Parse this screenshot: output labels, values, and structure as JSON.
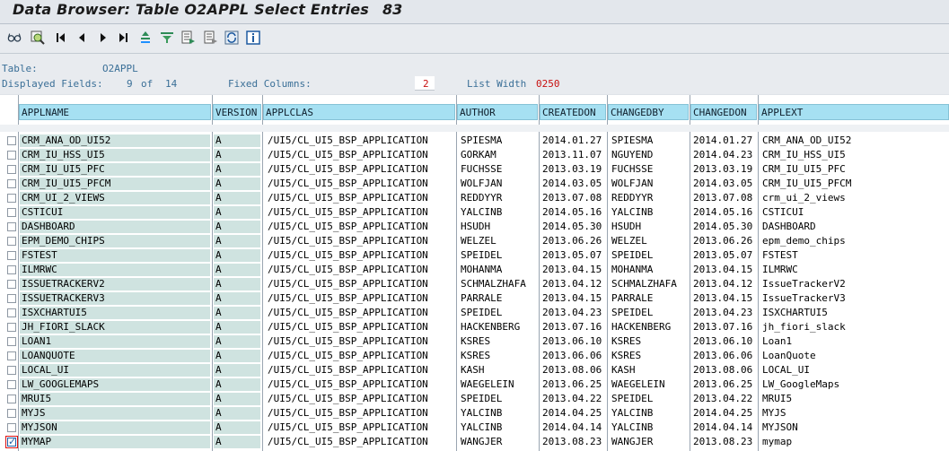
{
  "title": "Data Browser: Table O2APPL Select Entries",
  "entry_count": "83",
  "toolbar": {
    "icons": [
      "glasses-icon",
      "detail-icon",
      "first-page-icon",
      "prev-page-icon",
      "next-page-icon",
      "last-page-icon",
      "sort-icon",
      "filter-icon",
      "check-table-icon",
      "export-icon",
      "refresh-icon",
      "info-icon"
    ]
  },
  "info": {
    "table_label": "Table:",
    "table_value": "O2APPL",
    "displayed_label": "Displayed Fields:",
    "displayed_value": "9",
    "of_label": "of",
    "total_fields": "14",
    "fixed_label": "Fixed Columns:",
    "fixed_value": "2",
    "listwidth_label": "List Width",
    "listwidth_value": "0250"
  },
  "columns": [
    "APPLNAME",
    "VERSION",
    "APPLCLAS",
    "AUTHOR",
    "CREATEDON",
    "CHANGEDBY",
    "CHANGEDON",
    "APPLEXT"
  ],
  "rows": [
    {
      "applname": "CRM_ANA_OD_UI52",
      "version": "A",
      "applclas": "/UI5/CL_UI5_BSP_APPLICATION",
      "author": "SPIESMA",
      "createdon": "2014.01.27",
      "changedby": "SPIESMA",
      "changedon": "2014.01.27",
      "applext": "CRM_ANA_OD_UI52",
      "checked": false
    },
    {
      "applname": "CRM_IU_HSS_UI5",
      "version": "A",
      "applclas": "/UI5/CL_UI5_BSP_APPLICATION",
      "author": "GORKAM",
      "createdon": "2013.11.07",
      "changedby": "NGUYEND",
      "changedon": "2014.04.23",
      "applext": "CRM_IU_HSS_UI5",
      "checked": false
    },
    {
      "applname": "CRM_IU_UI5_PFC",
      "version": "A",
      "applclas": "/UI5/CL_UI5_BSP_APPLICATION",
      "author": "FUCHSSE",
      "createdon": "2013.03.19",
      "changedby": "FUCHSSE",
      "changedon": "2013.03.19",
      "applext": "CRM_IU_UI5_PFC",
      "checked": false
    },
    {
      "applname": "CRM_IU_UI5_PFCM",
      "version": "A",
      "applclas": "/UI5/CL_UI5_BSP_APPLICATION",
      "author": "WOLFJAN",
      "createdon": "2014.03.05",
      "changedby": "WOLFJAN",
      "changedon": "2014.03.05",
      "applext": "CRM_IU_UI5_PFCM",
      "checked": false
    },
    {
      "applname": "CRM_UI_2_VIEWS",
      "version": "A",
      "applclas": "/UI5/CL_UI5_BSP_APPLICATION",
      "author": "REDDYYR",
      "createdon": "2013.07.08",
      "changedby": "REDDYYR",
      "changedon": "2013.07.08",
      "applext": "crm_ui_2_views",
      "checked": false
    },
    {
      "applname": "CSTICUI",
      "version": "A",
      "applclas": "/UI5/CL_UI5_BSP_APPLICATION",
      "author": "YALCINB",
      "createdon": "2014.05.16",
      "changedby": "YALCINB",
      "changedon": "2014.05.16",
      "applext": "CSTICUI",
      "checked": false
    },
    {
      "applname": "DASHBOARD",
      "version": "A",
      "applclas": "/UI5/CL_UI5_BSP_APPLICATION",
      "author": "HSUDH",
      "createdon": "2014.05.30",
      "changedby": "HSUDH",
      "changedon": "2014.05.30",
      "applext": "DASHBOARD",
      "checked": false
    },
    {
      "applname": "EPM_DEMO_CHIPS",
      "version": "A",
      "applclas": "/UI5/CL_UI5_BSP_APPLICATION",
      "author": "WELZEL",
      "createdon": "2013.06.26",
      "changedby": "WELZEL",
      "changedon": "2013.06.26",
      "applext": "epm_demo_chips",
      "checked": false
    },
    {
      "applname": "FSTEST",
      "version": "A",
      "applclas": "/UI5/CL_UI5_BSP_APPLICATION",
      "author": "SPEIDEL",
      "createdon": "2013.05.07",
      "changedby": "SPEIDEL",
      "changedon": "2013.05.07",
      "applext": "FSTEST",
      "checked": false
    },
    {
      "applname": "ILMRWC",
      "version": "A",
      "applclas": "/UI5/CL_UI5_BSP_APPLICATION",
      "author": "MOHANMA",
      "createdon": "2013.04.15",
      "changedby": "MOHANMA",
      "changedon": "2013.04.15",
      "applext": "ILMRWC",
      "checked": false
    },
    {
      "applname": "ISSUETRACKERV2",
      "version": "A",
      "applclas": "/UI5/CL_UI5_BSP_APPLICATION",
      "author": "SCHMALZHAFA",
      "createdon": "2013.04.12",
      "changedby": "SCHMALZHAFA",
      "changedon": "2013.04.12",
      "applext": "IssueTrackerV2",
      "checked": false
    },
    {
      "applname": "ISSUETRACKERV3",
      "version": "A",
      "applclas": "/UI5/CL_UI5_BSP_APPLICATION",
      "author": "PARRALE",
      "createdon": "2013.04.15",
      "changedby": "PARRALE",
      "changedon": "2013.04.15",
      "applext": "IssueTrackerV3",
      "checked": false
    },
    {
      "applname": "ISXCHARTUI5",
      "version": "A",
      "applclas": "/UI5/CL_UI5_BSP_APPLICATION",
      "author": "SPEIDEL",
      "createdon": "2013.04.23",
      "changedby": "SPEIDEL",
      "changedon": "2013.04.23",
      "applext": "ISXCHARTUI5",
      "checked": false
    },
    {
      "applname": "JH_FIORI_SLACK",
      "version": "A",
      "applclas": "/UI5/CL_UI5_BSP_APPLICATION",
      "author": "HACKENBERG",
      "createdon": "2013.07.16",
      "changedby": "HACKENBERG",
      "changedon": "2013.07.16",
      "applext": "jh_fiori_slack",
      "checked": false
    },
    {
      "applname": "LOAN1",
      "version": "A",
      "applclas": "/UI5/CL_UI5_BSP_APPLICATION",
      "author": "KSRES",
      "createdon": "2013.06.10",
      "changedby": "KSRES",
      "changedon": "2013.06.10",
      "applext": "Loan1",
      "checked": false
    },
    {
      "applname": "LOANQUOTE",
      "version": "A",
      "applclas": "/UI5/CL_UI5_BSP_APPLICATION",
      "author": "KSRES",
      "createdon": "2013.06.06",
      "changedby": "KSRES",
      "changedon": "2013.06.06",
      "applext": "LoanQuote",
      "checked": false
    },
    {
      "applname": "LOCAL_UI",
      "version": "A",
      "applclas": "/UI5/CL_UI5_BSP_APPLICATION",
      "author": "KASH",
      "createdon": "2013.08.06",
      "changedby": "KASH",
      "changedon": "2013.08.06",
      "applext": "LOCAL_UI",
      "checked": false
    },
    {
      "applname": "LW_GOOGLEMAPS",
      "version": "A",
      "applclas": "/UI5/CL_UI5_BSP_APPLICATION",
      "author": "WAEGELEIN",
      "createdon": "2013.06.25",
      "changedby": "WAEGELEIN",
      "changedon": "2013.06.25",
      "applext": "LW_GoogleMaps",
      "checked": false
    },
    {
      "applname": "MRUI5",
      "version": "A",
      "applclas": "/UI5/CL_UI5_BSP_APPLICATION",
      "author": "SPEIDEL",
      "createdon": "2013.04.22",
      "changedby": "SPEIDEL",
      "changedon": "2013.04.22",
      "applext": "MRUI5",
      "checked": false
    },
    {
      "applname": "MYJS",
      "version": "A",
      "applclas": "/UI5/CL_UI5_BSP_APPLICATION",
      "author": "YALCINB",
      "createdon": "2014.04.25",
      "changedby": "YALCINB",
      "changedon": "2014.04.25",
      "applext": "MYJS",
      "checked": false
    },
    {
      "applname": "MYJSON",
      "version": "A",
      "applclas": "/UI5/CL_UI5_BSP_APPLICATION",
      "author": "YALCINB",
      "createdon": "2014.04.14",
      "changedby": "YALCINB",
      "changedon": "2014.04.14",
      "applext": "MYJSON",
      "checked": false
    },
    {
      "applname": "MYMAP",
      "version": "A",
      "applclas": "/UI5/CL_UI5_BSP_APPLICATION",
      "author": "WANGJER",
      "createdon": "2013.08.23",
      "changedby": "WANGJER",
      "changedon": "2013.08.23",
      "applext": "mymap",
      "checked": true
    }
  ]
}
